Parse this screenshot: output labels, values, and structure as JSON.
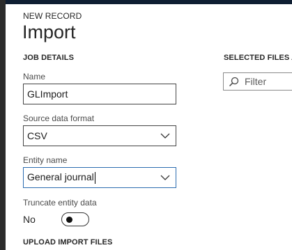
{
  "header": {
    "record_type": "NEW RECORD",
    "title": "Import"
  },
  "job_details": {
    "heading": "JOB DETAILS",
    "name": {
      "label": "Name",
      "value": "GLImport"
    },
    "source_data_format": {
      "label": "Source data format",
      "value": "CSV",
      "icon": "chevron-down-icon"
    },
    "entity_name": {
      "label": "Entity name",
      "value": "General journal",
      "icon": "chevron-down-icon"
    },
    "truncate_entity_data": {
      "label": "Truncate entity data",
      "state_text": "No",
      "on": false
    }
  },
  "selected_files": {
    "heading": "SELECTED FILES AN",
    "filter_placeholder": "Filter",
    "icon": "search-icon"
  },
  "upload": {
    "heading": "UPLOAD IMPORT FILES"
  },
  "colors": {
    "topbar": "#0f1e32",
    "focus_border": "#2b6cb0",
    "text": "#262626"
  }
}
